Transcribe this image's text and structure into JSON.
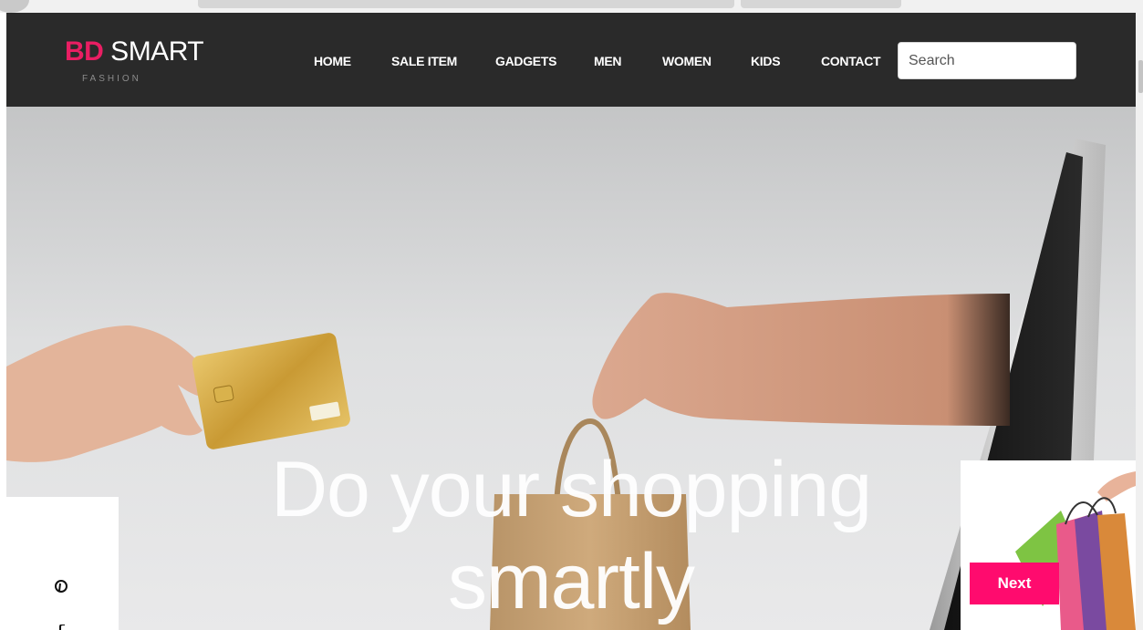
{
  "brand": {
    "accent_text": "BD",
    "main_text": " SMART",
    "tagline": "FASHION",
    "accent_color": "#e91e63"
  },
  "nav": {
    "items": [
      "HOME",
      "SALE ITEM",
      "GADGETS",
      "MEN",
      "WOMEN",
      "KIDS",
      "CONTACT"
    ]
  },
  "search": {
    "placeholder": "Search"
  },
  "hero": {
    "title_line1": "Do your shopping",
    "title_line2": "smartly"
  },
  "social": {
    "icons": [
      "pinterest-icon",
      "facebook-icon"
    ]
  },
  "carousel": {
    "next_label": "Next",
    "next_color": "#ff0b6e"
  }
}
